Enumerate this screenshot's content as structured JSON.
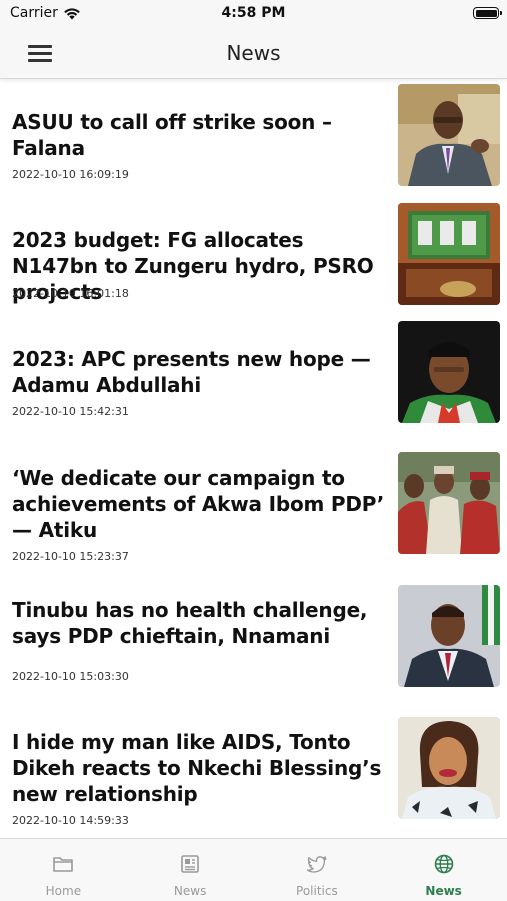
{
  "status_bar": {
    "carrier": "Carrier",
    "time": "4:58 PM"
  },
  "nav": {
    "title": "News",
    "menu_icon": "hamburger-menu-icon"
  },
  "articles": [
    {
      "headline": "ASUU to call off strike soon – Falana",
      "timestamp": "2022-10-10 16:09:19",
      "thumbnail": "man-in-suit-speaking-photo"
    },
    {
      "headline": "2023 budget: FG allocates N147bn to Zungeru hydro, PSRO projects",
      "timestamp": "2022-10-10 16:01:18",
      "thumbnail": "green-budget-box-photo"
    },
    {
      "headline": "2023: APC presents new hope — Adamu Abdullahi",
      "timestamp": "2022-10-10 15:42:31",
      "thumbnail": "man-in-cap-photo"
    },
    {
      "headline": "‘We dedicate our campaign to achievements of Akwa Ibom PDP’ — Atiku",
      "timestamp": "2022-10-10 15:23:37",
      "thumbnail": "campaign-crowd-photo"
    },
    {
      "headline": "Tinubu has no health challenge, says PDP chieftain, Nnamani",
      "timestamp": "2022-10-10 15:03:30",
      "thumbnail": "man-with-flag-photo"
    },
    {
      "headline": "I hide my man like AIDS, Tonto Dikeh reacts to Nkechi Blessing’s new relationship",
      "timestamp": "2022-10-10 14:59:33",
      "thumbnail": "woman-smiling-photo"
    }
  ],
  "tabs": [
    {
      "label": "Home",
      "icon": "folder-icon"
    },
    {
      "label": "News",
      "icon": "newspaper-icon"
    },
    {
      "label": "Politics",
      "icon": "twitter-bird-icon"
    },
    {
      "label": "News",
      "icon": "globe-icon"
    }
  ],
  "colors": {
    "active_tab": "#2e7d4f",
    "inactive_tab": "#9a9a9a"
  }
}
